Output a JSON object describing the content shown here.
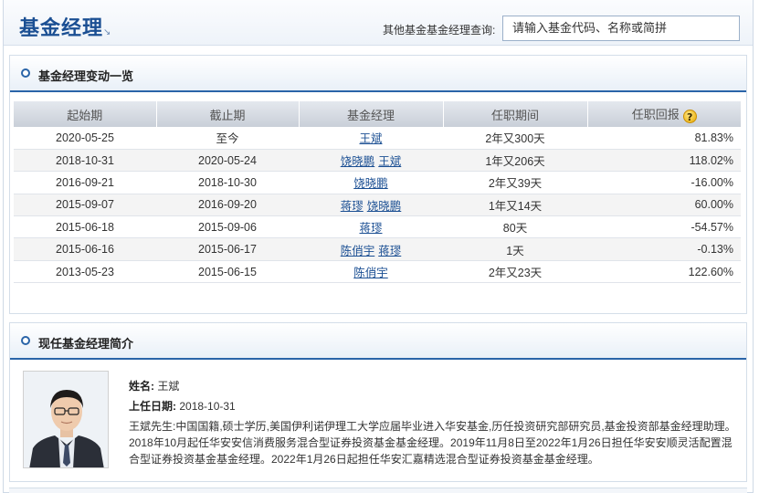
{
  "header": {
    "title": "基金经理",
    "title_arrow": "↘",
    "search_label": "其他基金基金经理查询:",
    "search_placeholder": "请输入基金代码、名称或简拼"
  },
  "changes": {
    "section_title": "基金经理变动一览",
    "columns": [
      "起始期",
      "截止期",
      "基金经理",
      "任职期间",
      "任职回报"
    ],
    "help_icon_glyph": "?",
    "rows": [
      {
        "start": "2020-05-25",
        "end": "至今",
        "managers": [
          "王斌"
        ],
        "duration": "2年又300天",
        "return": "81.83%"
      },
      {
        "start": "2018-10-31",
        "end": "2020-05-24",
        "managers": [
          "饶晓鹏",
          "王斌"
        ],
        "duration": "1年又206天",
        "return": "118.02%"
      },
      {
        "start": "2016-09-21",
        "end": "2018-10-30",
        "managers": [
          "饶晓鹏"
        ],
        "duration": "2年又39天",
        "return": "-16.00%"
      },
      {
        "start": "2015-09-07",
        "end": "2016-09-20",
        "managers": [
          "蒋璆",
          "饶晓鹏"
        ],
        "duration": "1年又14天",
        "return": "60.00%"
      },
      {
        "start": "2015-06-18",
        "end": "2015-09-06",
        "managers": [
          "蒋璆"
        ],
        "duration": "80天",
        "return": "-54.57%"
      },
      {
        "start": "2015-06-16",
        "end": "2015-06-17",
        "managers": [
          "陈俏宇",
          "蒋璆"
        ],
        "duration": "1天",
        "return": "-0.13%"
      },
      {
        "start": "2013-05-23",
        "end": "2015-06-15",
        "managers": [
          "陈俏宇"
        ],
        "duration": "2年又23天",
        "return": "122.60%"
      }
    ]
  },
  "profile": {
    "section_title": "现任基金经理简介",
    "name_label": "姓名:",
    "name": "王斌",
    "start_label": "上任日期:",
    "start_date": "2018-10-31",
    "bio": "王斌先生:中国国籍,硕士学历,美国伊利诺伊理工大学应届毕业进入华安基金,历任投资研究部研究员,基金投资部基金经理助理。2018年10月起任华安安信消费服务混合型证券投资基金基金经理。2019年11月8日至2022年1月26日担任华安安顺灵活配置混合型证券投资基金基金经理。2022年1月26日起担任华安汇嘉精选混合型证券投资基金基金经理。"
  },
  "colors": {
    "brand_blue": "#1b4f93",
    "positive": "#d0021b",
    "negative": "#1e8a1e"
  }
}
